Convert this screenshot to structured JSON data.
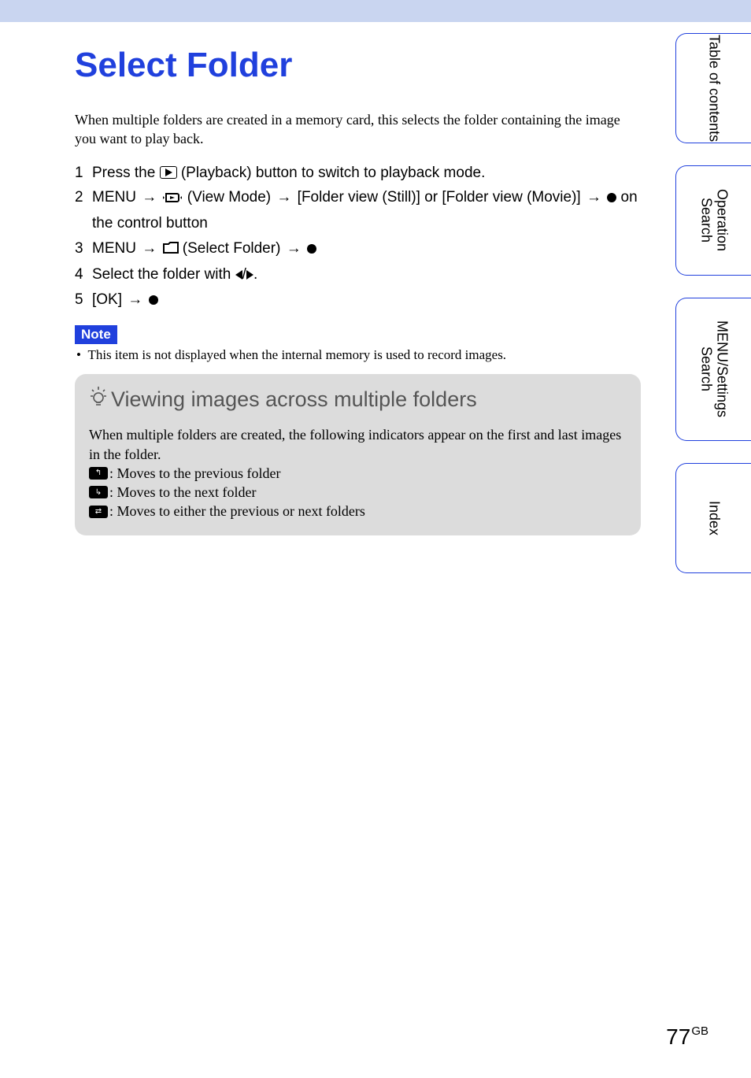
{
  "title": "Select Folder",
  "intro": "When multiple folders are created in a memory card, this selects the folder containing the image you want to play back.",
  "steps": [
    {
      "num": "1",
      "pre": "Press the ",
      "mid": " (Playback) button to switch to playback mode."
    },
    {
      "num": "2",
      "a": "MENU",
      "b": " (View Mode)",
      "c": " [Folder view (Still)] or [Folder view (Movie)]",
      "d": " on the control button"
    },
    {
      "num": "3",
      "a": "MENU",
      "b": " (Select Folder)"
    },
    {
      "num": "4",
      "text": "Select the folder with "
    },
    {
      "num": "5",
      "text": "[OK]"
    }
  ],
  "note_label": "Note",
  "note_text": "This item is not displayed when the internal memory is used to record images.",
  "tip_title": "Viewing images across multiple folders",
  "tip_intro": "When multiple folders are created, the following indicators appear on the first and last images in the folder.",
  "indicators": [
    ": Moves to the previous folder",
    ": Moves to the next folder",
    ": Moves to either the previous or next folders"
  ],
  "tabs": {
    "toc": "Table of contents",
    "op": "Operation Search",
    "menu": "MENU/Settings Search",
    "idx": "Index"
  },
  "page_number": "77",
  "page_region": "GB"
}
